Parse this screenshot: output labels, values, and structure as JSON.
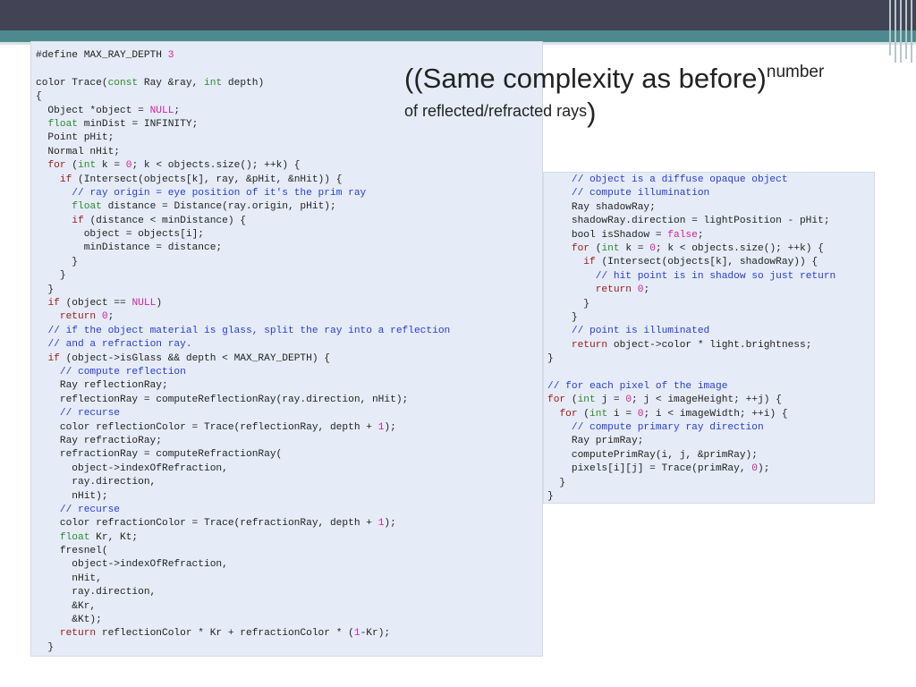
{
  "slide": {
    "title": {
      "main": "((Same complexity as before)",
      "superscript": "number",
      "line2": "of  reflected/refracted  rays",
      "close_paren": ")"
    }
  },
  "code_left": [
    [
      [
        "#define MAX_RAY_DEPTH ",
        "plain"
      ],
      [
        "3",
        "lit"
      ]
    ],
    [
      [
        "",
        "plain"
      ]
    ],
    [
      [
        "color Trace(",
        "plain"
      ],
      [
        "const",
        "type"
      ],
      [
        " Ray &ray, ",
        "plain"
      ],
      [
        "int",
        "type"
      ],
      [
        " depth)",
        "plain"
      ]
    ],
    [
      [
        "{",
        "plain"
      ]
    ],
    [
      [
        "  Object *object = ",
        "plain"
      ],
      [
        "NULL",
        "lit"
      ],
      [
        ";",
        "plain"
      ]
    ],
    [
      [
        "  ",
        "plain"
      ],
      [
        "float",
        "type"
      ],
      [
        " minDist = INFINITY;",
        "plain"
      ]
    ],
    [
      [
        "  Point pHit;",
        "plain"
      ]
    ],
    [
      [
        "  Normal nHit;",
        "plain"
      ]
    ],
    [
      [
        "  ",
        "plain"
      ],
      [
        "for",
        "kw"
      ],
      [
        " (",
        "plain"
      ],
      [
        "int",
        "type"
      ],
      [
        " k = ",
        "plain"
      ],
      [
        "0",
        "lit"
      ],
      [
        "; k < objects.size(); ++k) {",
        "plain"
      ]
    ],
    [
      [
        "    ",
        "plain"
      ],
      [
        "if",
        "kw"
      ],
      [
        " (Intersect(objects[k], ray, &pHit, &nHit)) {",
        "plain"
      ]
    ],
    [
      [
        "      ",
        "plain"
      ],
      [
        "// ray origin = eye position of it's the prim ray",
        "cmt"
      ]
    ],
    [
      [
        "      ",
        "plain"
      ],
      [
        "float",
        "type"
      ],
      [
        " distance = Distance(ray.origin, pHit);",
        "plain"
      ]
    ],
    [
      [
        "      ",
        "plain"
      ],
      [
        "if",
        "kw"
      ],
      [
        " (distance < minDistance) {",
        "plain"
      ]
    ],
    [
      [
        "        object = objects[i];",
        "plain"
      ]
    ],
    [
      [
        "        minDistance = distance;",
        "plain"
      ]
    ],
    [
      [
        "      }",
        "plain"
      ]
    ],
    [
      [
        "    }",
        "plain"
      ]
    ],
    [
      [
        "  }",
        "plain"
      ]
    ],
    [
      [
        "  ",
        "plain"
      ],
      [
        "if",
        "kw"
      ],
      [
        " (object == ",
        "plain"
      ],
      [
        "NULL",
        "lit"
      ],
      [
        ")",
        "plain"
      ]
    ],
    [
      [
        "    ",
        "plain"
      ],
      [
        "return",
        "kw"
      ],
      [
        " ",
        "plain"
      ],
      [
        "0",
        "lit"
      ],
      [
        ";",
        "plain"
      ]
    ],
    [
      [
        "  ",
        "plain"
      ],
      [
        "// if the object material is glass, split the ray into a reflection",
        "cmt"
      ]
    ],
    [
      [
        "  ",
        "plain"
      ],
      [
        "// and a refraction ray.",
        "cmt"
      ]
    ],
    [
      [
        "  ",
        "plain"
      ],
      [
        "if",
        "kw"
      ],
      [
        " (object->isGlass && depth < MAX_RAY_DEPTH) {",
        "plain"
      ]
    ],
    [
      [
        "    ",
        "plain"
      ],
      [
        "// compute reflection",
        "cmt"
      ]
    ],
    [
      [
        "    Ray reflectionRay;",
        "plain"
      ]
    ],
    [
      [
        "    reflectionRay = computeReflectionRay(ray.direction, nHit);",
        "plain"
      ]
    ],
    [
      [
        "    ",
        "plain"
      ],
      [
        "// recurse",
        "cmt"
      ]
    ],
    [
      [
        "    color reflectionColor = Trace(reflectionRay, depth + ",
        "plain"
      ],
      [
        "1",
        "lit"
      ],
      [
        ");",
        "plain"
      ]
    ],
    [
      [
        "    Ray refractioRay;",
        "plain"
      ]
    ],
    [
      [
        "    refractionRay = computeRefractionRay(",
        "plain"
      ]
    ],
    [
      [
        "      object->indexOfRefraction,",
        "plain"
      ]
    ],
    [
      [
        "      ray.direction,",
        "plain"
      ]
    ],
    [
      [
        "      nHit);",
        "plain"
      ]
    ],
    [
      [
        "    ",
        "plain"
      ],
      [
        "// recurse",
        "cmt"
      ]
    ],
    [
      [
        "    color refractionColor = Trace(refractionRay, depth + ",
        "plain"
      ],
      [
        "1",
        "lit"
      ],
      [
        ");",
        "plain"
      ]
    ],
    [
      [
        "    ",
        "plain"
      ],
      [
        "float",
        "type"
      ],
      [
        " Kr, Kt;",
        "plain"
      ]
    ],
    [
      [
        "    fresnel(",
        "plain"
      ]
    ],
    [
      [
        "      object->indexOfRefraction,",
        "plain"
      ]
    ],
    [
      [
        "      nHit,",
        "plain"
      ]
    ],
    [
      [
        "      ray.direction,",
        "plain"
      ]
    ],
    [
      [
        "      &Kr,",
        "plain"
      ]
    ],
    [
      [
        "      &Kt);",
        "plain"
      ]
    ],
    [
      [
        "    ",
        "plain"
      ],
      [
        "return",
        "kw"
      ],
      [
        " reflectionColor * Kr + refractionColor * (",
        "plain"
      ],
      [
        "1",
        "lit"
      ],
      [
        "-Kr);",
        "plain"
      ]
    ],
    [
      [
        "  }",
        "plain"
      ]
    ]
  ],
  "code_right": [
    [
      [
        "    ",
        "plain"
      ],
      [
        "// object is a diffuse opaque object",
        "cmt"
      ]
    ],
    [
      [
        "    ",
        "plain"
      ],
      [
        "// compute illumination",
        "cmt"
      ]
    ],
    [
      [
        "    Ray shadowRay;",
        "plain"
      ]
    ],
    [
      [
        "    shadowRay.direction = lightPosition - pHit;",
        "plain"
      ]
    ],
    [
      [
        "    bool isShadow = ",
        "plain"
      ],
      [
        "false",
        "lit"
      ],
      [
        ";",
        "plain"
      ]
    ],
    [
      [
        "    ",
        "plain"
      ],
      [
        "for",
        "kw"
      ],
      [
        " (",
        "plain"
      ],
      [
        "int",
        "type"
      ],
      [
        " k = ",
        "plain"
      ],
      [
        "0",
        "lit"
      ],
      [
        "; k < objects.size(); ++k) {",
        "plain"
      ]
    ],
    [
      [
        "      ",
        "plain"
      ],
      [
        "if",
        "kw"
      ],
      [
        " (Intersect(objects[k], shadowRay)) {",
        "plain"
      ]
    ],
    [
      [
        "        ",
        "plain"
      ],
      [
        "// hit point is in shadow so just return",
        "cmt"
      ]
    ],
    [
      [
        "        ",
        "plain"
      ],
      [
        "return",
        "kw"
      ],
      [
        " ",
        "plain"
      ],
      [
        "0",
        "lit"
      ],
      [
        ";",
        "plain"
      ]
    ],
    [
      [
        "      }",
        "plain"
      ]
    ],
    [
      [
        "    }",
        "plain"
      ]
    ],
    [
      [
        "    ",
        "plain"
      ],
      [
        "// point is illuminated",
        "cmt"
      ]
    ],
    [
      [
        "    ",
        "plain"
      ],
      [
        "return",
        "kw"
      ],
      [
        " object->color * light.brightness;",
        "plain"
      ]
    ],
    [
      [
        "}",
        "plain"
      ]
    ],
    [
      [
        "",
        "plain"
      ]
    ],
    [
      [
        "",
        "plain"
      ],
      [
        "// for each pixel of the image",
        "cmt"
      ]
    ],
    [
      [
        "",
        "plain"
      ],
      [
        "for",
        "kw"
      ],
      [
        " (",
        "plain"
      ],
      [
        "int",
        "type"
      ],
      [
        " j = ",
        "plain"
      ],
      [
        "0",
        "lit"
      ],
      [
        "; j < imageHeight; ++j) {",
        "plain"
      ]
    ],
    [
      [
        "  ",
        "plain"
      ],
      [
        "for",
        "kw"
      ],
      [
        " (",
        "plain"
      ],
      [
        "int",
        "type"
      ],
      [
        " i = ",
        "plain"
      ],
      [
        "0",
        "lit"
      ],
      [
        "; i < imageWidth; ++i) {",
        "plain"
      ]
    ],
    [
      [
        "    ",
        "plain"
      ],
      [
        "// compute primary ray direction",
        "cmt"
      ]
    ],
    [
      [
        "    Ray primRay;",
        "plain"
      ]
    ],
    [
      [
        "    computePrimRay(i, j, &primRay);",
        "plain"
      ]
    ],
    [
      [
        "    pixels[i][j] = Trace(primRay, ",
        "plain"
      ],
      [
        "0",
        "lit"
      ],
      [
        ");",
        "plain"
      ]
    ],
    [
      [
        "  }",
        "plain"
      ]
    ],
    [
      [
        "}",
        "plain"
      ]
    ]
  ]
}
